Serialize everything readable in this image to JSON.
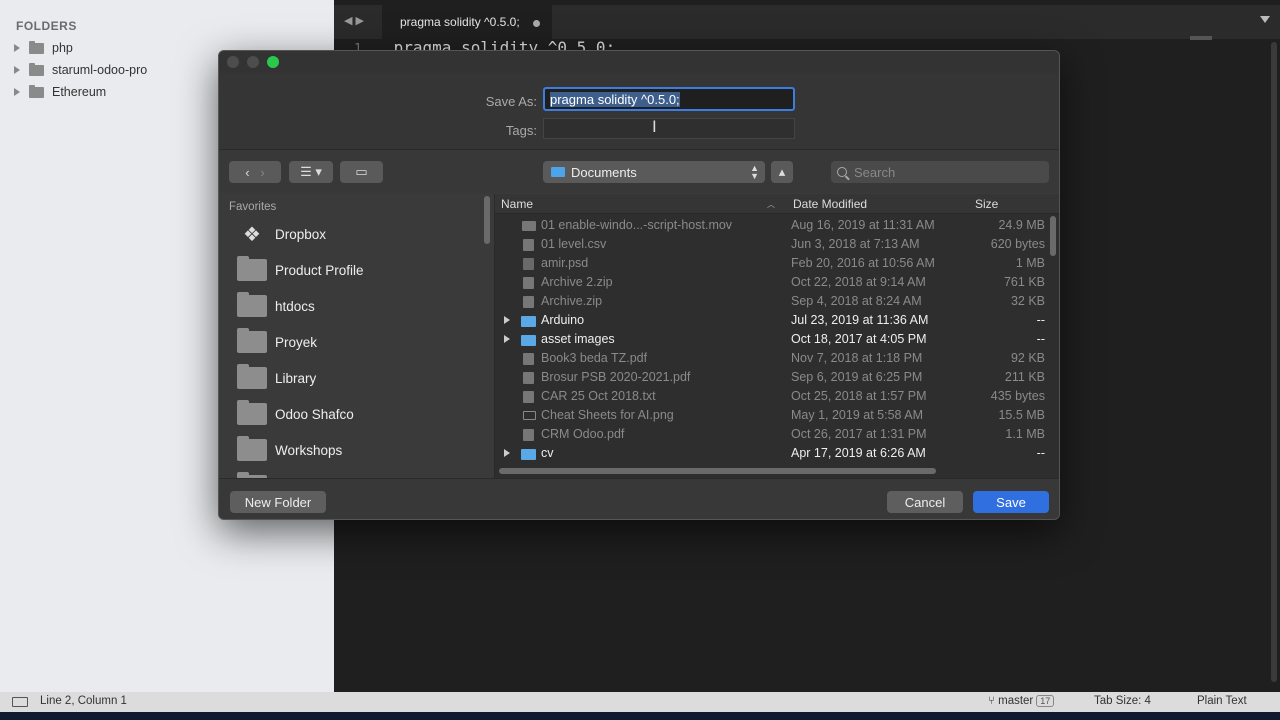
{
  "sidebar": {
    "header": "FOLDERS",
    "folders": [
      "php",
      "staruml-odoo-pro",
      "Ethereum"
    ]
  },
  "editor": {
    "tab_title": "pragma solidity ^0.5.0;",
    "line_number": "1",
    "code_line": "pragma solidity ^0.5.0;"
  },
  "status_bar": {
    "position": "Line 2, Column 1",
    "branch": "master",
    "branch_count": "17",
    "tab_size": "Tab Size: 4",
    "syntax": "Plain Text"
  },
  "dialog": {
    "save_as_label": "Save As:",
    "save_as_value": "pragma solidity ^0.5.0;",
    "tags_label": "Tags:",
    "location": "Documents",
    "search_placeholder": "Search",
    "favorites_title": "Favorites",
    "favorites": [
      "Dropbox",
      "Product Profile",
      "htdocs",
      "Proyek",
      "Library",
      "Odoo Shafco",
      "Workshops"
    ],
    "columns": {
      "name": "Name",
      "date": "Date Modified",
      "size": "Size"
    },
    "files": [
      {
        "name": "01 enable-windo...-script-host.mov",
        "date": "Aug 16, 2019 at 11:31 AM",
        "size": "24.9 MB"
      },
      {
        "name": "01 level.csv",
        "date": "Jun 3, 2018 at 7:13 AM",
        "size": "620 bytes"
      },
      {
        "name": "amir.psd",
        "date": "Feb 20, 2016 at 10:56 AM",
        "size": "1 MB"
      },
      {
        "name": "Archive 2.zip",
        "date": "Oct 22, 2018 at 9:14 AM",
        "size": "761 KB"
      },
      {
        "name": "Archive.zip",
        "date": "Sep 4, 2018 at 8:24 AM",
        "size": "32 KB"
      },
      {
        "name": "Arduino",
        "date": "Jul 23, 2019 at 11:36 AM",
        "size": "--"
      },
      {
        "name": "asset images",
        "date": "Oct 18, 2017 at 4:05 PM",
        "size": "--"
      },
      {
        "name": "Book3 beda TZ.pdf",
        "date": "Nov 7, 2018 at 1:18 PM",
        "size": "92 KB"
      },
      {
        "name": "Brosur PSB 2020-2021.pdf",
        "date": "Sep 6, 2019 at 6:25 PM",
        "size": "211 KB"
      },
      {
        "name": "CAR 25 Oct 2018.txt",
        "date": "Oct 25, 2018 at 1:57 PM",
        "size": "435 bytes"
      },
      {
        "name": "Cheat Sheets for AI.png",
        "date": "May 1, 2019 at 5:58 AM",
        "size": "15.5 MB"
      },
      {
        "name": "CRM Odoo.pdf",
        "date": "Oct 26, 2017 at 1:31 PM",
        "size": "1.1 MB"
      },
      {
        "name": "cv",
        "date": "Apr 17, 2019 at 6:26 AM",
        "size": "--"
      }
    ],
    "new_folder": "New Folder",
    "cancel": "Cancel",
    "save": "Save"
  },
  "colors": {
    "accent": "#2f6fdf",
    "folder": "#5aa8e6"
  }
}
